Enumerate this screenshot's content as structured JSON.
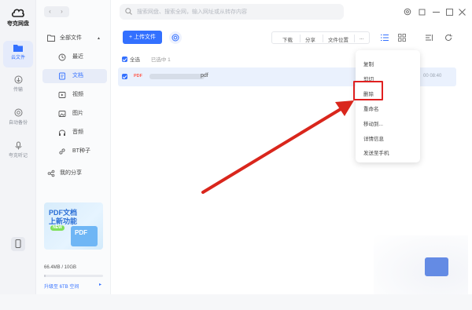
{
  "app": {
    "name": "夸克网盘"
  },
  "rail": [
    {
      "label": "云文件",
      "icon": "cloud-folder-icon",
      "active": true
    },
    {
      "label": "传输",
      "icon": "transfer-icon",
      "active": false
    },
    {
      "label": "自动备份",
      "icon": "backup-icon",
      "active": false
    },
    {
      "label": "夸克听记",
      "icon": "microphone-icon",
      "active": false
    }
  ],
  "nav": {
    "back": "‹",
    "forward": "›"
  },
  "sidebar": {
    "all_files": "全部文件",
    "items": [
      {
        "label": "最近",
        "icon": "clock-icon"
      },
      {
        "label": "文档",
        "icon": "document-icon",
        "selected": true
      },
      {
        "label": "视频",
        "icon": "video-icon"
      },
      {
        "label": "图片",
        "icon": "image-icon"
      },
      {
        "label": "音频",
        "icon": "headphones-icon"
      },
      {
        "label": "BT种子",
        "icon": "link-icon"
      }
    ],
    "share": "我的分享"
  },
  "promo": {
    "line1": "PDF文档",
    "line2": "上新功能",
    "badge": "NEW",
    "doc_label": "PDF"
  },
  "storage": {
    "text": "66.4MB / 10GB",
    "used_fraction": 0.006,
    "upgrade": "升级至 6TB 空间",
    "upgrade_arrow": "▸"
  },
  "search": {
    "placeholder": "搜索网盘、搜索全网，输入网址或从转存内容"
  },
  "toolbar": {
    "upload": "上传文件",
    "download": "下载",
    "share": "分享",
    "file_location": "文件位置",
    "more": "..."
  },
  "list": {
    "select_all": "全选",
    "selected_count": "已选中 1",
    "rows": [
      {
        "type_badge": "PDF",
        "ext": "pdf",
        "time": "00 08:40"
      }
    ]
  },
  "context_menu": {
    "items": [
      "复制",
      "剪切",
      "删除",
      "重命名",
      "移动到...",
      "详情信息",
      "发送至手机"
    ],
    "highlighted": "删除"
  },
  "colors": {
    "accent": "#3370ff",
    "highlight": "#e02020",
    "arrow": "#d9261c"
  }
}
